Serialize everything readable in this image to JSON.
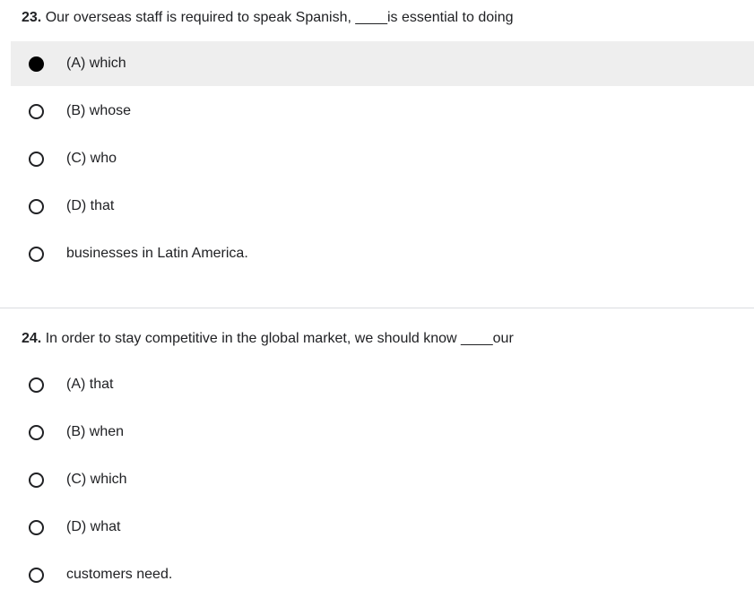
{
  "questions": [
    {
      "number": "23.",
      "text": "Our overseas staff is required to speak Spanish, ____is essential to doing",
      "options": [
        {
          "label": "(A) which",
          "selected": true
        },
        {
          "label": "(B) whose",
          "selected": false
        },
        {
          "label": "(C) who",
          "selected": false
        },
        {
          "label": "(D) that",
          "selected": false
        },
        {
          "label": "businesses in Latin America.",
          "selected": false
        }
      ]
    },
    {
      "number": "24.",
      "text": "In order to stay competitive in the global market, we should know ____our",
      "options": [
        {
          "label": "(A) that",
          "selected": false
        },
        {
          "label": "(B) when",
          "selected": false
        },
        {
          "label": "(C) which",
          "selected": false
        },
        {
          "label": "(D) what",
          "selected": false
        },
        {
          "label": "customers need.",
          "selected": false
        }
      ]
    }
  ],
  "colors": {
    "selected_row_background": "#eeeeee",
    "divider": "#dadce0",
    "text": "#202124"
  }
}
